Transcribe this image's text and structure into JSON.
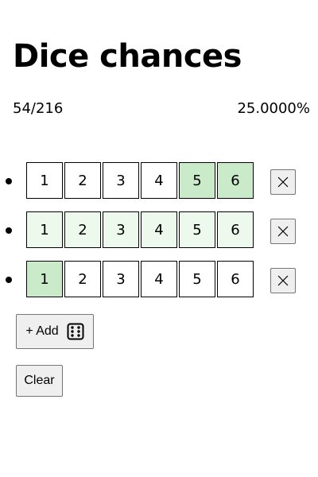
{
  "page": {
    "title": "Dice chances",
    "fraction": "54/216",
    "percentage": "25.0000%"
  },
  "dice": [
    {
      "faces": [
        "1",
        "2",
        "3",
        "4",
        "5",
        "6"
      ],
      "states": [
        "off",
        "off",
        "off",
        "off",
        "on",
        "on"
      ]
    },
    {
      "faces": [
        "1",
        "2",
        "3",
        "4",
        "5",
        "6"
      ],
      "states": [
        "light",
        "light",
        "light",
        "light",
        "light",
        "light"
      ]
    },
    {
      "faces": [
        "1",
        "2",
        "3",
        "4",
        "5",
        "6"
      ],
      "states": [
        "on",
        "off",
        "off",
        "off",
        "off",
        "off"
      ]
    }
  ],
  "controls": {
    "add_label": "+ Add",
    "clear_label": "Clear",
    "add_icon": "dice-six-icon",
    "remove_icon": "close-icon"
  },
  "colors": {
    "selected_face": "#c9ebc9",
    "light_face": "#eef9ee"
  }
}
